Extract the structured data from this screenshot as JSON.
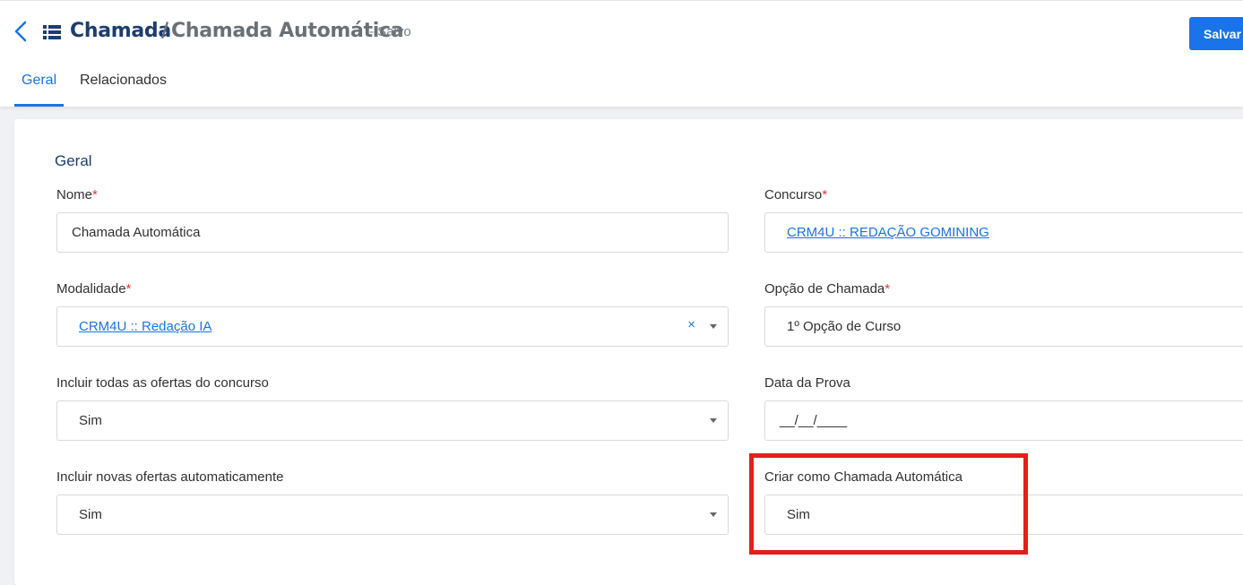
{
  "header": {
    "title": "Chamada",
    "separator": "/",
    "subtitle": "Chamada Automática",
    "status": "- Salvo",
    "save_label": "Salvar"
  },
  "tabs": [
    {
      "label": "Geral",
      "active": true
    },
    {
      "label": "Relacionados",
      "active": false
    }
  ],
  "section": {
    "title": "Geral"
  },
  "form": {
    "nome": {
      "label": "Nome",
      "required": "*",
      "value": "Chamada Automática"
    },
    "concurso": {
      "label": "Concurso",
      "required": "*",
      "value": "CRM4U :: REDAÇÃO GOMINING"
    },
    "modalidade": {
      "label": "Modalidade",
      "required": "*",
      "value": "CRM4U :: Redação IA",
      "clear": "×"
    },
    "opcao_chamada": {
      "label": "Opção de Chamada",
      "required": "*",
      "value": "1º Opção de Curso"
    },
    "incluir_todas": {
      "label": "Incluir todas as ofertas do concurso",
      "value": "Sim"
    },
    "data_prova": {
      "label": "Data da Prova",
      "value": "__/__/____"
    },
    "incluir_novas": {
      "label": "Incluir novas ofertas automaticamente",
      "value": "Sim"
    },
    "criar_automatica": {
      "label": "Criar como Chamada Automática",
      "value": "Sim"
    }
  },
  "colors": {
    "accent": "#1a73e8",
    "title": "#1d3d70",
    "required": "#e53935",
    "highlight": "#e41e1e"
  }
}
